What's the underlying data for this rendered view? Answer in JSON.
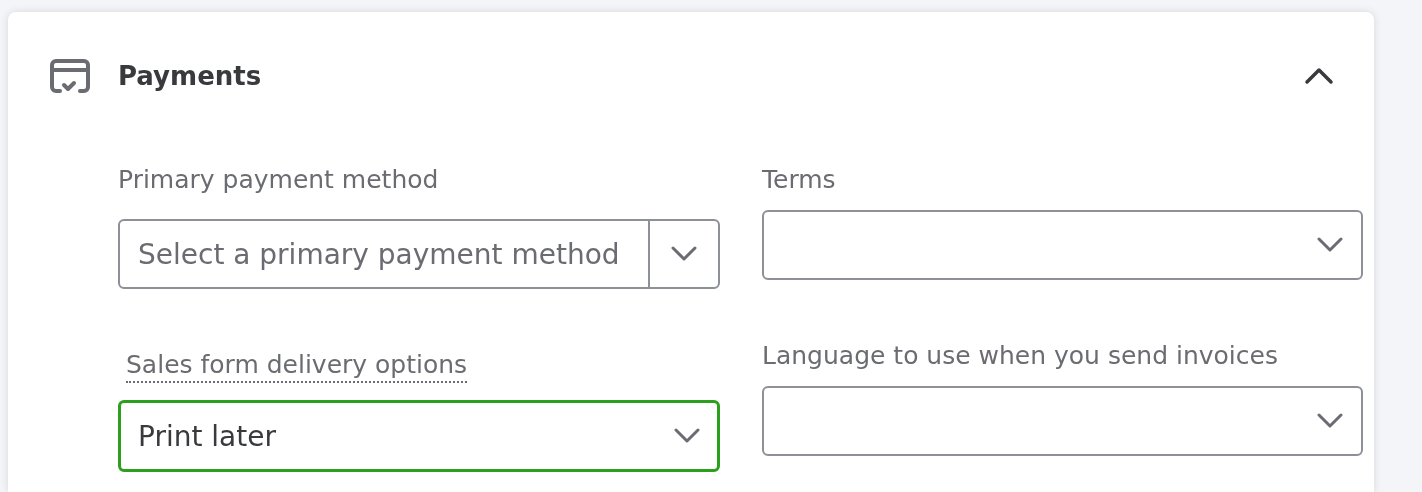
{
  "card": {
    "title": "Payments",
    "expanded": true
  },
  "fields": [
    {
      "kind": "split-select",
      "label": "Primary payment method",
      "placeholder": "Select a primary payment method",
      "focused": false,
      "has_tooltip": false
    },
    {
      "kind": "select",
      "label": "Terms",
      "focused": false,
      "has_tooltip": false
    },
    {
      "kind": "select",
      "label": "Sales form delivery options",
      "value": "Print later",
      "focused": true,
      "has_tooltip": true
    },
    {
      "kind": "select",
      "label": "Language to use when you send invoices",
      "focused": false,
      "has_tooltip": false
    }
  ]
}
